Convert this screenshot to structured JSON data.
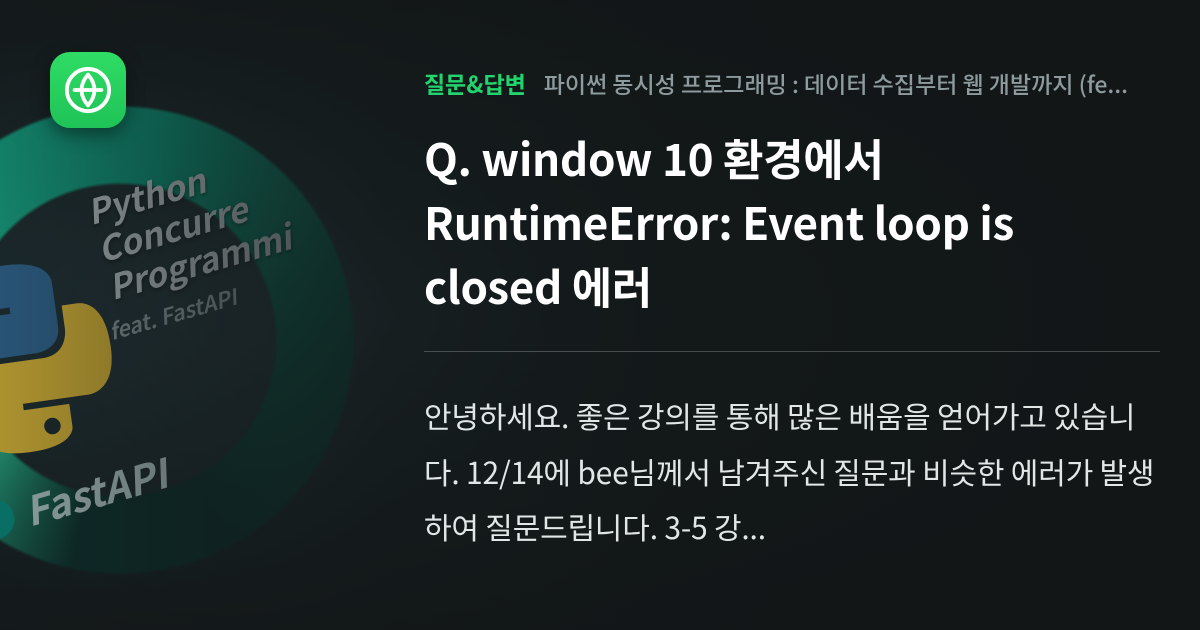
{
  "colors": {
    "accent": "#22d46d",
    "background": "#141a1c",
    "text_primary": "#ffffff",
    "text_secondary": "#8d9a9e"
  },
  "logo": {
    "name": "inflearn-logo"
  },
  "thumbnail": {
    "title_line1": "Python",
    "title_line2": "Concurre",
    "title_line3": "Programmi",
    "subtitle": "feat. FastAPI",
    "badge": "FastAPI"
  },
  "meta": {
    "category": "질문&답변",
    "course": "파이썬 동시성 프로그래밍 : 데이터 수집부터 웹 개발까지 (fe..."
  },
  "post": {
    "title": "Q. window 10 환경에서 RuntimeError: Event loop is closed 에러",
    "body": "안녕하세요. 좋은 강의를 통해 많은 배움을 얻어가고 있습니다. 12/14에 bee님께서 남겨주신 질문과 비슷한 에러가 발생하여 질문드립니다. 3-5 강..."
  }
}
